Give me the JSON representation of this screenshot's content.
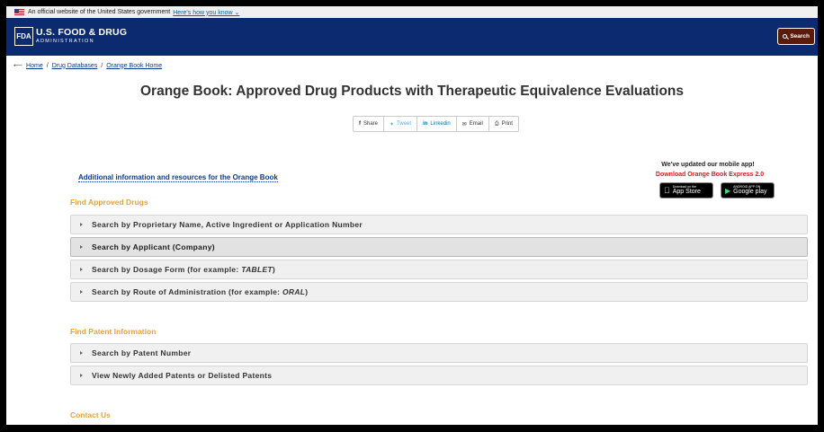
{
  "gov_banner": {
    "text": "An official website of the United States government",
    "link": "Here's how you know ⌄"
  },
  "header": {
    "logo_mark": "FDA",
    "title": "U.S. FOOD & DRUG",
    "subtitle": "ADMINISTRATION",
    "search_label": "Search"
  },
  "breadcrumb": {
    "items": [
      "Home",
      "Drug Databases",
      "Orange Book Home"
    ],
    "separator": "/"
  },
  "page_title": "Orange Book: Approved Drug Products with Therapeutic Equivalence Evaluations",
  "share": {
    "facebook": "Share",
    "twitter": "Tweet",
    "linkedin": "Linkedin",
    "email": "Email",
    "print": "Print"
  },
  "additional_info_link": "Additional information and resources for the Orange Book",
  "app_promo": {
    "headline": "We've updated our mobile app!",
    "link": "Download Orange Book Express 2.0",
    "app_store": {
      "small": "Download on the",
      "big": "App Store"
    },
    "google_play": {
      "small": "ANDROID APP ON",
      "big": "Google play"
    }
  },
  "sections": {
    "approved_drugs": {
      "heading": "Find Approved Drugs",
      "items": [
        {
          "label": "Search by Proprietary Name, Active Ingredient or Application Number",
          "example": "",
          "suffix": ""
        },
        {
          "label": "Search by Applicant (Company)",
          "example": "",
          "suffix": ""
        },
        {
          "label": "Search by Dosage Form (for example: ",
          "example": "TABLET",
          "suffix": ")"
        },
        {
          "label": "Search by Route of Administration (for example: ",
          "example": "ORAL",
          "suffix": ")"
        }
      ]
    },
    "patent_info": {
      "heading": "Find Patent Information",
      "items": [
        {
          "label": "Search by Patent Number"
        },
        {
          "label": "View Newly Added Patents or Delisted Patents"
        }
      ]
    },
    "contact": {
      "heading": "Contact Us"
    }
  },
  "colors": {
    "header_bg": "#0b2a6f",
    "section_heading": "#e8a13a",
    "promo_link": "#d21c1c",
    "link": "#0b3a8c"
  }
}
